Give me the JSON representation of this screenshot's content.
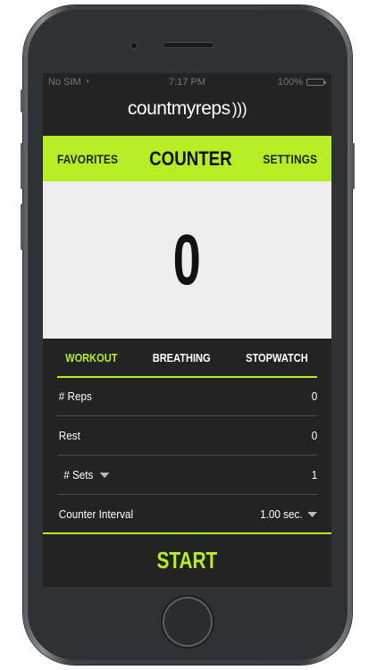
{
  "status_bar": {
    "carrier": "No SIM",
    "wifi_icon": "wifi-icon",
    "time": "7:17 PM",
    "battery": "100%"
  },
  "app": {
    "logo_text": "countmyreps",
    "logo_icon": "sound-waves-icon"
  },
  "nav": {
    "left": "FAVORITES",
    "title": "COUNTER",
    "right": "SETTINGS",
    "accent_color": "#b5ee25"
  },
  "counter": {
    "value": "0"
  },
  "tabs": [
    {
      "label": "WORKOUT",
      "active": true
    },
    {
      "label": "BREATHING",
      "active": false
    },
    {
      "label": "STOPWATCH",
      "active": false
    }
  ],
  "rows": [
    {
      "label": "# Reps",
      "value": "0"
    },
    {
      "label": "Rest",
      "value": "0"
    },
    {
      "label": "# Sets",
      "value": "1",
      "dropdown": true
    },
    {
      "label": "Counter Interval",
      "value": "1.00 sec.",
      "dropdown": true
    }
  ],
  "start_label": "START"
}
